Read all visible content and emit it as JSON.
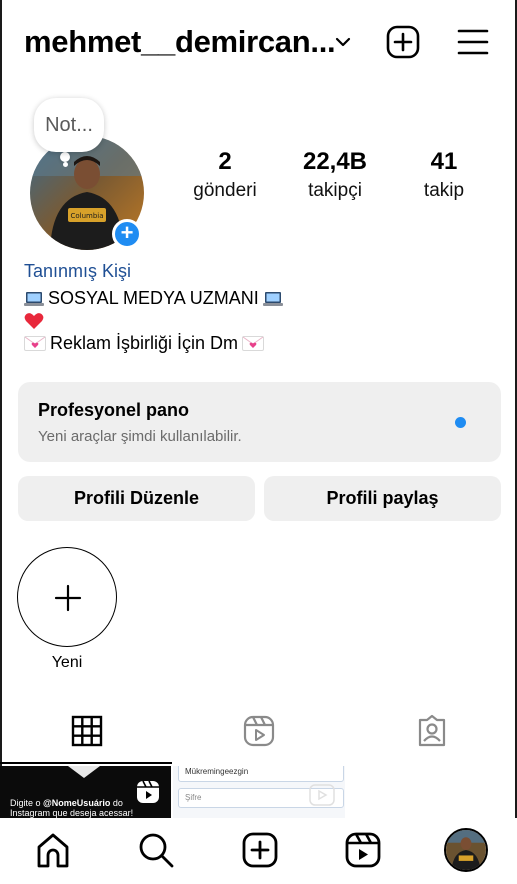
{
  "header": {
    "username": "mehmet__demircan...",
    "icons": [
      "chevron-down-icon",
      "create-plus-icon",
      "menu-icon"
    ]
  },
  "profile": {
    "note_text": "Not...",
    "stats": [
      {
        "number": "2",
        "label": "gönderi"
      },
      {
        "number": "22,4B",
        "label": "takipçi"
      },
      {
        "number": "41",
        "label": "takip"
      }
    ],
    "display_name": "Tanınmış Kişi",
    "bio_line1": "SOSYAL MEDYA UZMANI",
    "bio_line3": "Reklam İşbirliği İçin Dm"
  },
  "dashboard": {
    "title": "Profesyonel pano",
    "subtitle": "Yeni araçlar şimdi kullanılabilir."
  },
  "buttons": {
    "edit": "Profili Düzenle",
    "share": "Profili paylaş"
  },
  "highlights": {
    "new_label": "Yeni"
  },
  "posts": [
    {
      "text_bold": "@NomeUsuário",
      "text_pre": "Digite o ",
      "text_post": " do",
      "text_line2": "Instagram que deseja acessar!"
    },
    {
      "field1": "Mükremingeezgin",
      "field2": "Şifre"
    }
  ],
  "colors": {
    "accent_blue": "#1f8cf2",
    "name_blue": "#1f4f94",
    "button_grey": "#efefef"
  }
}
